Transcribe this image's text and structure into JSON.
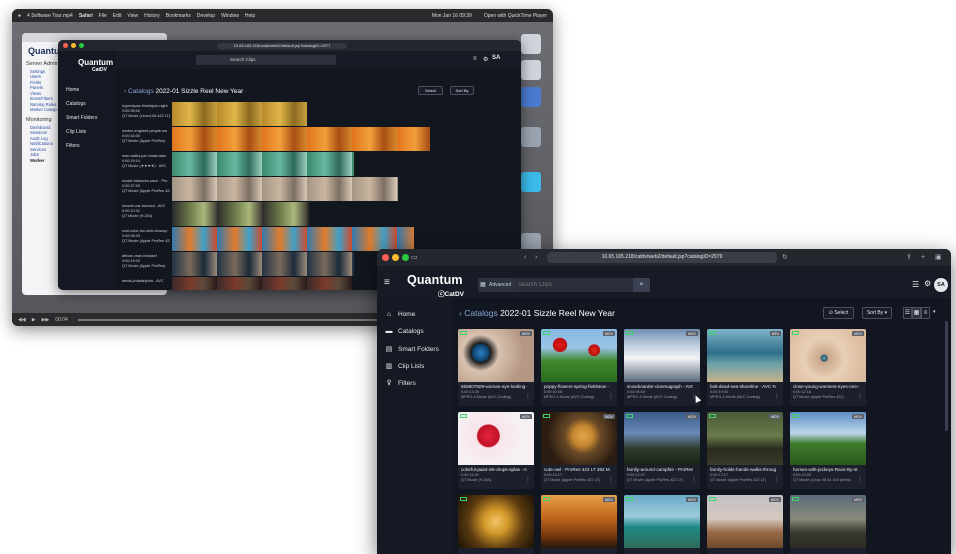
{
  "bg": {
    "menubar": {
      "title": "4 Software Tour.mp4",
      "items": [
        "Safari",
        "File",
        "Edit",
        "View",
        "History",
        "Bookmarks",
        "Develop",
        "Window",
        "Help"
      ],
      "right_text": "Mon Jan 16 09:39",
      "open_with": "Open with QuickTime Player"
    },
    "playback": {
      "time": "00:04"
    },
    "admin": {
      "logo": "Quantum",
      "title": "Server Admin",
      "section1": [
        "Settings",
        "Users",
        "Fields",
        "Panels",
        "Views",
        "Items/Filters",
        "Naming Rules",
        "Marker Categories"
      ],
      "monitoring": "Monitoring",
      "section2": [
        "Dashboard",
        "Sessions",
        "Audit Log",
        "Notifications",
        "Services",
        "Jobs",
        "Worker"
      ]
    },
    "mid": {
      "url": "10.65.165.218/catdv/web2/default.jsp?catalogID=2977",
      "logo": "Quantum",
      "sub": "CatDV",
      "search": "Search Clips",
      "nav": [
        "Home",
        "Catalogs",
        "Smart Folders",
        "Clip Lists",
        "Filters"
      ],
      "crumb_link": "Catalogs",
      "crumb_title": "2022-01 Sizzle Reel New Year",
      "rows": [
        {
          "name": "hyperlapse-timelapse-night",
          "dur": "0:00:08:02",
          "fmt": "QT Movie (Linux10A 422 LT)"
        },
        {
          "name": "london-england-people-wa",
          "dur": "0:00:18:00",
          "fmt": "QT Movie (Apple ProRes)"
        },
        {
          "name": "man-walks-join-boats-lake",
          "dur": "0:00:19:14",
          "fmt": "QT Movie (★★★★) · AVC"
        },
        {
          "name": "model-balances-save - Pro",
          "dur": "0:00:27:09",
          "fmt": "QT Movie (Apple ProRes 422)"
        },
        {
          "name": "muscle-car-burnout - AVC",
          "dur": "0:00:10:01",
          "fmt": "QT Movie (H.264)"
        },
        {
          "name": "cool-color-fun-skin-closeup",
          "dur": "0:00:05:03",
          "fmt": "QT Movie (Apple ProRes 422)"
        },
        {
          "name": "african-man-headset",
          "dur": "0:00:19:03",
          "fmt": "QT Movie (Apple ProRes)"
        },
        {
          "name": "aerial-philadelphia - AVC",
          "dur": "",
          "fmt": ""
        }
      ],
      "buttons": {
        "select": "Select",
        "sort": "Sort By"
      }
    }
  },
  "fg": {
    "url": "10.65.165.218/catdv/web2/default.jsp?catalogID=2979",
    "logo": "Quantum",
    "logo_sub": "CatDV",
    "adv_label": "Advanced",
    "search_placeholder": "Search Clips",
    "avatar": "SA",
    "nav": [
      {
        "label": "Home",
        "icon": "home-icon"
      },
      {
        "label": "Catalogs",
        "icon": "folder-icon"
      },
      {
        "label": "Smart Folders",
        "icon": "smart-folder-icon"
      },
      {
        "label": "Clip Lists",
        "icon": "list-icon"
      },
      {
        "label": "Filters",
        "icon": "filter-icon"
      }
    ],
    "crumb_link": "Catalogs",
    "crumb_title": "2022-01 Sizzle Reel New Year",
    "select_label": "Select",
    "sort_label": "Sort By",
    "clips": [
      {
        "name": "555807509-woman-eye-looking-",
        "dur": "0:00:13:26",
        "fmt": "MPEG-4 Movie (AVC Coding)",
        "badge": "MOV"
      },
      {
        "name": "poppy-flowers-spring-fieldstow -",
        "dur": "0:00:10:08",
        "fmt": "MPEG-4 Movie (AVC Coding)",
        "badge": "MOV"
      },
      {
        "name": "snowboarder-cinemagraph - AVC",
        "dur": "0:00:06:03",
        "fmt": "MPEG-4 Movie (AVC Coding)",
        "badge": "MOV"
      },
      {
        "name": "bolt-dead-sea-shoreline - AVC FA",
        "dur": "0:00:19:00",
        "fmt": "MPEG-4 Movie (AVC Coding)",
        "badge": "MP4"
      },
      {
        "name": "close-young-womens-eyes-one-s",
        "dur": "0:00:12:16",
        "fmt": "QT Movie (Apple ProRes 422)",
        "badge": "MOV"
      },
      {
        "name": "colorful-paint-ink-drops-splas - A",
        "dur": "0:00:11:04",
        "fmt": "QT Movie (H.264)",
        "badge": "MOV"
      },
      {
        "name": "cute-owl - ProRes 422 LT 352 Mb",
        "dur": "0:00:13:17",
        "fmt": "QT Movie (Apple ProRes 422 LT)",
        "badge": "MOV"
      },
      {
        "name": "family-around-campfire - ProRes",
        "dur": "0:00:12:07",
        "fmt": "QT Movie (Apple ProRes 422 LT)",
        "badge": "MOV"
      },
      {
        "name": "family-holds-hands-walks-throug -",
        "dur": "0:00:17:17",
        "fmt": "QT Movie (Apple ProRes 422 LT)",
        "badge": "MOV"
      },
      {
        "name": "horses-with-jockeys-Race-By-st",
        "dur": "0:00:13:00",
        "fmt": "QT Movie (Linux 08.44 100 pixels)",
        "badge": "MOV"
      },
      {
        "name": "",
        "dur": "",
        "fmt": "",
        "badge": ""
      },
      {
        "name": "",
        "dur": "",
        "fmt": "",
        "badge": "MOV"
      },
      {
        "name": "",
        "dur": "",
        "fmt": "",
        "badge": "MOV"
      },
      {
        "name": "",
        "dur": "",
        "fmt": "",
        "badge": "MOV"
      },
      {
        "name": "",
        "dur": "",
        "fmt": "",
        "badge": "MOV"
      }
    ],
    "colors": {
      "accent_link": "#8aa7d6",
      "clip_badge": "#3fd36b",
      "bg": "#111620"
    }
  }
}
